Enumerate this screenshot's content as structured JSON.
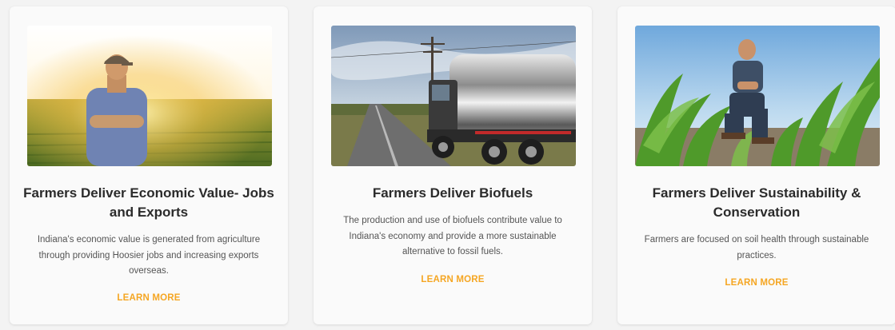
{
  "colors": {
    "accent": "#f5a623",
    "title": "#2b2b2b",
    "text": "#555555",
    "card_bg": "#fafafa",
    "page_bg": "#f3f3f3"
  },
  "cards": [
    {
      "image": "farmer-in-cornfield-at-sunrise",
      "title": "Farmers Deliver Economic Value- Jobs and Exports",
      "description": "Indiana's economic value is generated from agriculture through providing Hoosier jobs and increasing exports overseas.",
      "link_label": "LEARN MORE"
    },
    {
      "image": "tanker-truck-on-rural-road",
      "title": "Farmers Deliver Biofuels",
      "description": "The production and use of biofuels contribute value to Indiana's economy and provide a more sustainable alternative to fossil fuels.",
      "link_label": "LEARN MORE"
    },
    {
      "image": "farmer-kneeling-in-corn-crop",
      "title": "Farmers Deliver Sustainability & Conservation",
      "description": "Farmers are focused on soil health through sustainable practices.",
      "link_label": "LEARN MORE"
    }
  ]
}
